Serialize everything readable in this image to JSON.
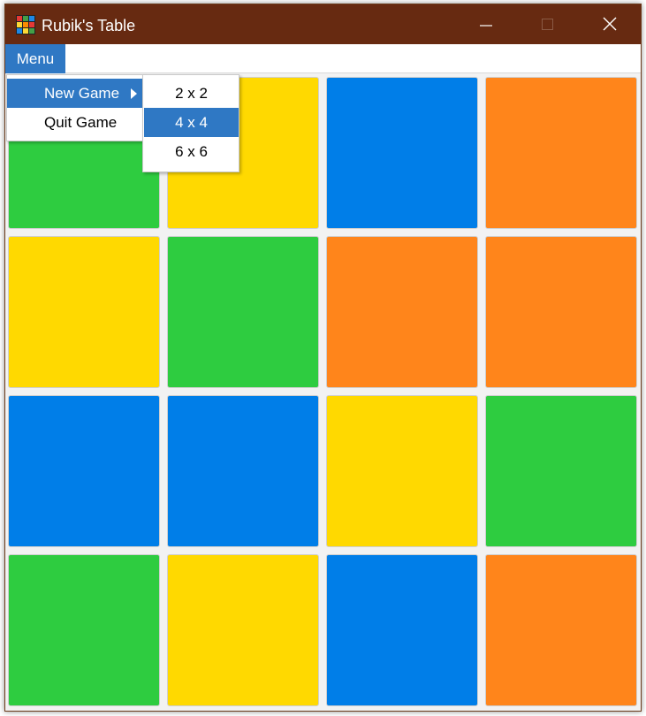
{
  "window": {
    "title": "Rubik's Table",
    "controls": {
      "minimize": "minimize-icon",
      "maximize": "maximize-icon",
      "close": "close-icon"
    }
  },
  "menubar": {
    "menu_label": "Menu"
  },
  "dropdown": {
    "items": [
      {
        "label": "New Game",
        "has_submenu": true,
        "highlighted": true
      },
      {
        "label": "Quit Game",
        "has_submenu": false,
        "highlighted": false
      }
    ]
  },
  "submenu": {
    "items": [
      {
        "label": "2 x 2",
        "highlighted": false
      },
      {
        "label": "4 x 4",
        "highlighted": true
      },
      {
        "label": "6 x 6",
        "highlighted": false
      }
    ]
  },
  "colors": {
    "titlebar": "#672a11",
    "highlight": "#2f78c4",
    "green": "#2ecc40",
    "yellow": "#ffd900",
    "blue": "#007ee8",
    "orange": "#ff851b"
  },
  "board": {
    "grid_size": 4,
    "tiles": [
      [
        "green",
        "yellow",
        "blue",
        "orange"
      ],
      [
        "yellow",
        "green",
        "orange",
        "orange"
      ],
      [
        "blue",
        "blue",
        "yellow",
        "green"
      ],
      [
        "green",
        "yellow",
        "blue",
        "orange"
      ]
    ]
  }
}
